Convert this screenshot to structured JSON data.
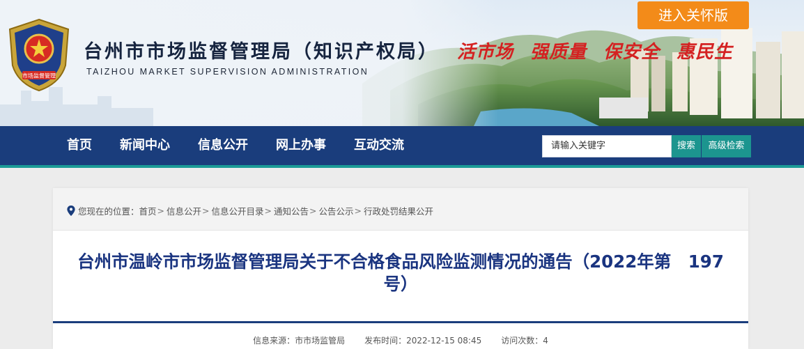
{
  "header": {
    "title": "台州市市场监督管理局（知识产权局）",
    "subtitle": "TAIZHOU MARKET SUPERVISION ADMINISTRATION",
    "slogans": [
      "活市场",
      "强质量",
      "保安全",
      "惠民生"
    ],
    "care_button": "进入关怀版",
    "logo_text": "市场监督管理"
  },
  "nav": {
    "items": [
      "首页",
      "新闻中心",
      "信息公开",
      "网上办事",
      "互动交流"
    ]
  },
  "search": {
    "placeholder": "请输入关键字",
    "button": "搜索",
    "advanced": "高级检索"
  },
  "breadcrumb": {
    "prefix": "您现在的位置：",
    "items": [
      "首页",
      "信息公开",
      "信息公开目录",
      "通知公告",
      "公告公示",
      "行政处罚结果公开"
    ],
    "separator": ">"
  },
  "article": {
    "title": "台州市温岭市市场监督管理局关于不合格食品风险监测情况的通告（2022年第　197号）",
    "source": "信息来源：市市场监管局",
    "published": "发布时间：2022-12-15 08:45",
    "visits": "访问次数：4"
  },
  "colors": {
    "nav_bg": "#1a3d7c",
    "accent_teal": "#1c958f",
    "care_orange": "#f38b19",
    "slogan_red": "#d42121",
    "title_blue": "#1a3480"
  }
}
